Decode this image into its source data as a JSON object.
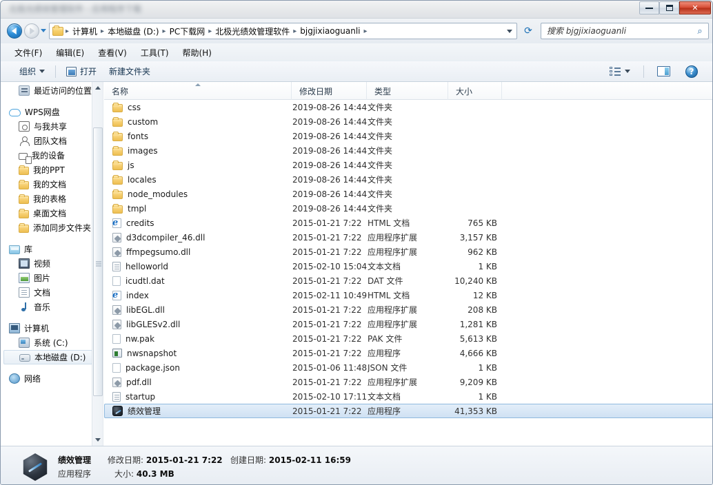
{
  "window": {
    "title_blurred": "北极光绩效管理软件 - 应用程序下载",
    "minimize_label": "最小化",
    "maximize_label": "最大化",
    "close_label": "关闭"
  },
  "address": {
    "back_label": "后退",
    "forward_label": "前进",
    "history_label": "最近浏览的位置",
    "refresh_label": "刷新",
    "breadcrumbs": [
      "计算机",
      "本地磁盘 (D:)",
      "PC下载网",
      "北极光绩效管理软件",
      "bjgjixiaoguanli"
    ],
    "separator": "▸"
  },
  "search": {
    "placeholder": "搜索 bjgjixiaoguanli",
    "value": "",
    "icon": "search-icon"
  },
  "menubar": {
    "items": [
      {
        "label": "文件(F)"
      },
      {
        "label": "编辑(E)"
      },
      {
        "label": "查看(V)"
      },
      {
        "label": "工具(T)"
      },
      {
        "label": "帮助(H)"
      }
    ]
  },
  "toolbar": {
    "organize_label": "组织",
    "open_label": "打开",
    "newfolder_label": "新建文件夹",
    "views_label": "更改您的视图",
    "preview_label": "显示预览窗格",
    "help_label": "?"
  },
  "sidebar": {
    "groups": [
      {
        "items": [
          {
            "label": "最近访问的位置",
            "icon": "recent-icon",
            "indent": 1
          }
        ]
      },
      {
        "items": [
          {
            "label": "WPS网盘",
            "icon": "cloud-icon",
            "indent": 0
          },
          {
            "label": "与我共享",
            "icon": "share-icon",
            "indent": 1
          },
          {
            "label": "团队文档",
            "icon": "team-icon",
            "indent": 1
          },
          {
            "label": "我的设备",
            "icon": "device-icon",
            "indent": 1
          },
          {
            "label": "我的PPT",
            "icon": "folder-icon",
            "indent": 1
          },
          {
            "label": "我的文档",
            "icon": "folder-icon",
            "indent": 1
          },
          {
            "label": "我的表格",
            "icon": "folder-icon",
            "indent": 1
          },
          {
            "label": "桌面文档",
            "icon": "folder-icon",
            "indent": 1
          },
          {
            "label": "添加同步文件夹",
            "icon": "folder-icon",
            "indent": 1
          }
        ]
      },
      {
        "items": [
          {
            "label": "库",
            "icon": "library-icon",
            "indent": 0
          },
          {
            "label": "视频",
            "icon": "video-icon",
            "indent": 1
          },
          {
            "label": "图片",
            "icon": "picture-icon",
            "indent": 1
          },
          {
            "label": "文档",
            "icon": "document-icon",
            "indent": 1
          },
          {
            "label": "音乐",
            "icon": "music-icon",
            "indent": 1
          }
        ]
      },
      {
        "items": [
          {
            "label": "计算机",
            "icon": "computer-icon",
            "indent": 0
          },
          {
            "label": "系统 (C:)",
            "icon": "system-drive-icon",
            "indent": 1
          },
          {
            "label": "本地磁盘 (D:)",
            "icon": "local-drive-icon",
            "indent": 1,
            "selected": true
          }
        ]
      },
      {
        "items": [
          {
            "label": "网络",
            "icon": "network-icon",
            "indent": 0
          }
        ]
      }
    ]
  },
  "filelist": {
    "columns": [
      {
        "key": "name",
        "label": "名称",
        "sorted": true
      },
      {
        "key": "date",
        "label": "修改日期",
        "sorted": false
      },
      {
        "key": "type",
        "label": "类型",
        "sorted": false
      },
      {
        "key": "size",
        "label": "大小",
        "sorted": false
      }
    ],
    "rows": [
      {
        "name": "css",
        "date": "2019-08-26 14:44",
        "type": "文件夹",
        "size": "",
        "icon": "folder-icon",
        "selected": false
      },
      {
        "name": "custom",
        "date": "2019-08-26 14:44",
        "type": "文件夹",
        "size": "",
        "icon": "folder-icon",
        "selected": false
      },
      {
        "name": "fonts",
        "date": "2019-08-26 14:44",
        "type": "文件夹",
        "size": "",
        "icon": "folder-icon",
        "selected": false
      },
      {
        "name": "images",
        "date": "2019-08-26 14:44",
        "type": "文件夹",
        "size": "",
        "icon": "folder-icon",
        "selected": false
      },
      {
        "name": "js",
        "date": "2019-08-26 14:44",
        "type": "文件夹",
        "size": "",
        "icon": "folder-icon",
        "selected": false
      },
      {
        "name": "locales",
        "date": "2019-08-26 14:44",
        "type": "文件夹",
        "size": "",
        "icon": "folder-icon",
        "selected": false
      },
      {
        "name": "node_modules",
        "date": "2019-08-26 14:44",
        "type": "文件夹",
        "size": "",
        "icon": "folder-icon",
        "selected": false
      },
      {
        "name": "tmpl",
        "date": "2019-08-26 14:44",
        "type": "文件夹",
        "size": "",
        "icon": "folder-icon",
        "selected": false
      },
      {
        "name": "credits",
        "date": "2015-01-21 7:22",
        "type": "HTML 文档",
        "size": "765 KB",
        "icon": "html-file-icon",
        "selected": false
      },
      {
        "name": "d3dcompiler_46.dll",
        "date": "2015-01-21 7:22",
        "type": "应用程序扩展",
        "size": "3,157 KB",
        "icon": "dll-file-icon",
        "selected": false
      },
      {
        "name": "ffmpegsumo.dll",
        "date": "2015-01-21 7:22",
        "type": "应用程序扩展",
        "size": "962 KB",
        "icon": "dll-file-icon",
        "selected": false
      },
      {
        "name": "helloworld",
        "date": "2015-02-10 15:04",
        "type": "文本文档",
        "size": "1 KB",
        "icon": "text-file-icon",
        "selected": false
      },
      {
        "name": "icudtl.dat",
        "date": "2015-01-21 7:22",
        "type": "DAT 文件",
        "size": "10,240 KB",
        "icon": "blank-file-icon",
        "selected": false
      },
      {
        "name": "index",
        "date": "2015-02-11 10:49",
        "type": "HTML 文档",
        "size": "12 KB",
        "icon": "html-file-icon",
        "selected": false
      },
      {
        "name": "libEGL.dll",
        "date": "2015-01-21 7:22",
        "type": "应用程序扩展",
        "size": "208 KB",
        "icon": "dll-file-icon",
        "selected": false
      },
      {
        "name": "libGLESv2.dll",
        "date": "2015-01-21 7:22",
        "type": "应用程序扩展",
        "size": "1,281 KB",
        "icon": "dll-file-icon",
        "selected": false
      },
      {
        "name": "nw.pak",
        "date": "2015-01-21 7:22",
        "type": "PAK 文件",
        "size": "5,613 KB",
        "icon": "blank-file-icon",
        "selected": false
      },
      {
        "name": "nwsnapshot",
        "date": "2015-01-21 7:22",
        "type": "应用程序",
        "size": "4,666 KB",
        "icon": "exe-file-icon",
        "selected": false
      },
      {
        "name": "package.json",
        "date": "2015-01-06 11:48",
        "type": "JSON 文件",
        "size": "1 KB",
        "icon": "blank-file-icon",
        "selected": false
      },
      {
        "name": "pdf.dll",
        "date": "2015-01-21 7:22",
        "type": "应用程序扩展",
        "size": "9,209 KB",
        "icon": "dll-file-icon",
        "selected": false
      },
      {
        "name": "startup",
        "date": "2015-02-10 17:11",
        "type": "文本文档",
        "size": "1 KB",
        "icon": "text-file-icon",
        "selected": false
      },
      {
        "name": "绩效管理",
        "date": "2015-01-21 7:22",
        "type": "应用程序",
        "size": "41,353 KB",
        "icon": "app-icon",
        "selected": true
      }
    ]
  },
  "statusbar": {
    "name": "绩效管理",
    "type": "应用程序",
    "modified_label": "修改日期:",
    "modified_value": "2015-01-21 7:22",
    "created_label": "创建日期:",
    "created_value": "2015-02-11 16:59",
    "size_label": "大小:",
    "size_value": "40.3 MB"
  },
  "colors": {
    "selection_border": "#8fb9de",
    "selection_fill": "#cfe1f3",
    "accent": "#1a6fb5",
    "close_red": "#d64c34"
  }
}
